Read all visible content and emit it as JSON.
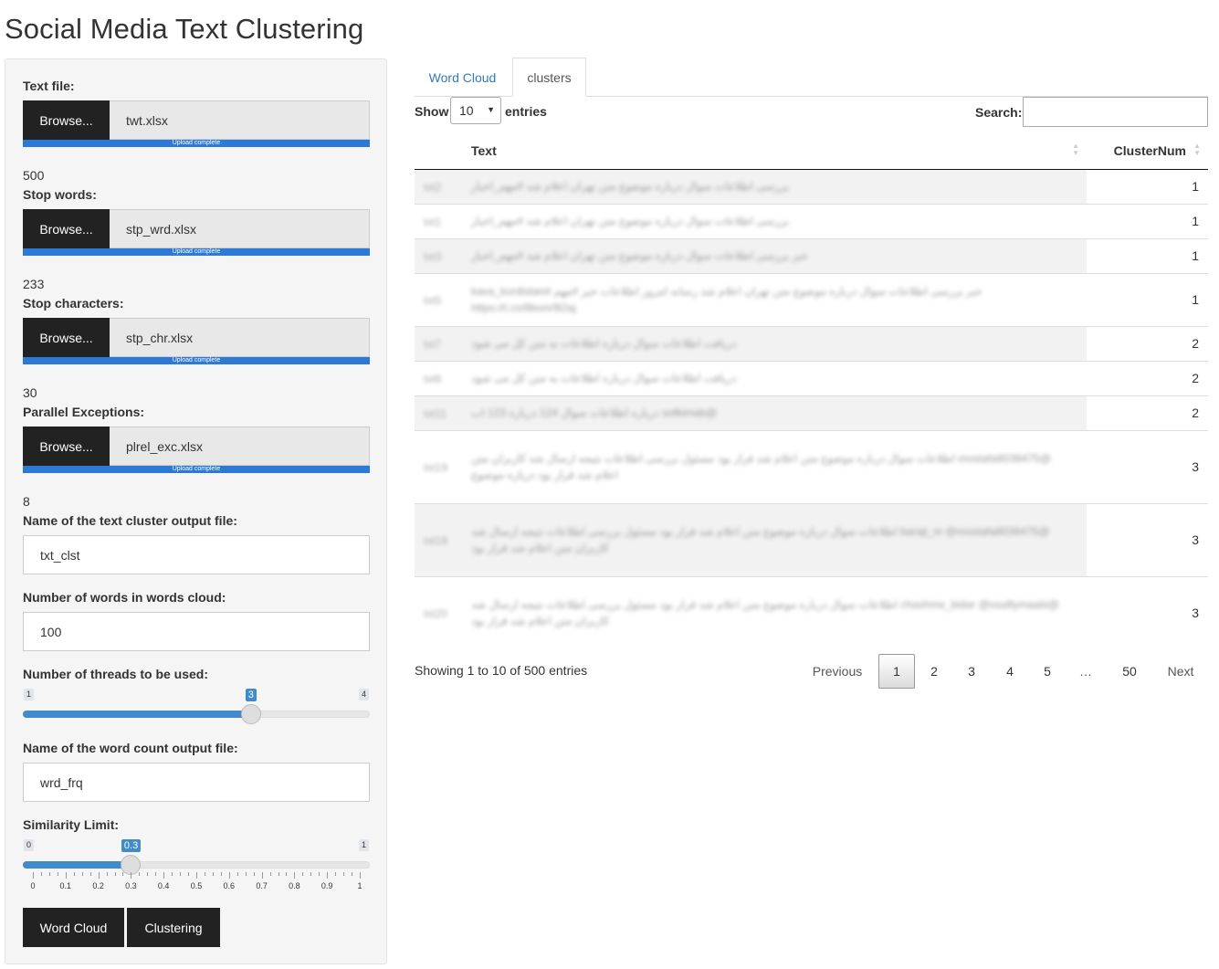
{
  "app_title": "Social Media Text Clustering",
  "sidebar": {
    "text_file": {
      "label": "Text file:",
      "browse": "Browse...",
      "file": "twt.xlsx",
      "progress": "Upload complete"
    },
    "count_500": "500",
    "stop_words": {
      "label": "Stop words:",
      "browse": "Browse...",
      "file": "stp_wrd.xlsx",
      "progress": "Upload complete"
    },
    "count_233": "233",
    "stop_chars": {
      "label": "Stop characters:",
      "browse": "Browse...",
      "file": "stp_chr.xlsx",
      "progress": "Upload complete"
    },
    "count_30": "30",
    "parallel_exc": {
      "label": "Parallel Exceptions:",
      "browse": "Browse...",
      "file": "plrel_exc.xlsx",
      "progress": "Upload complete"
    },
    "count_8": "8",
    "cluster_output": {
      "label": "Name of the text cluster output file:",
      "value": "txt_clst"
    },
    "words_cloud": {
      "label": "Number of words in words cloud:",
      "value": "100"
    },
    "threads": {
      "label": "Number of threads to be used:",
      "min": "1",
      "max": "4",
      "value": 3,
      "value_label": "3",
      "fraction": 0.667
    },
    "word_count_output": {
      "label": "Name of the word count output file:",
      "value": "wrd_frq"
    },
    "similarity": {
      "label": "Similarity Limit:",
      "min": "0",
      "max": "1",
      "value": 0.3,
      "value_label": "0.3",
      "fraction": 0.3,
      "ticks": [
        "0",
        "0.1",
        "0.2",
        "0.3",
        "0.4",
        "0.5",
        "0.6",
        "0.7",
        "0.8",
        "0.9",
        "1"
      ]
    },
    "buttons": {
      "word_cloud": "Word Cloud",
      "clustering": "Clustering"
    }
  },
  "tabs": {
    "word_cloud": "Word Cloud",
    "clusters": "clusters"
  },
  "table_controls": {
    "show": "Show",
    "page_size": "10",
    "entries": "entries",
    "search_label": "Search:"
  },
  "table": {
    "columns": [
      "",
      "Text",
      "ClusterNum"
    ],
    "rows": [
      {
        "id": "txt2",
        "text": "بررسی اطلاعات سوال درباره موضوع متن تهران اعلام شد #مهم_اخبار",
        "cluster": "1"
      },
      {
        "id": "txt1",
        "text": "بررسی اطلاعات سوال درباره موضوع متن تهران اعلام شد #مهم_اخبار",
        "cluster": "1"
      },
      {
        "id": "txt3",
        "text": "خبر بررسی اطلاعات سوال درباره موضوع متن تهران اعلام شد #مهم_اخبار",
        "cluster": "1"
      },
      {
        "id": "txt5",
        "text": "خبر بررسی اطلاعات سوال درباره موضوع متن تهران اعلام شد رسانه امروز اطلاعات خبر #مهم #kava_kurdistan https://t.co/8bonr9l2aj",
        "cluster": "1"
      },
      {
        "id": "txt7",
        "text": "دریافت اطلاعات سوال درباره اطلاعات به متن کل می شود",
        "cluster": "2"
      },
      {
        "id": "txt6",
        "text": "دریافت اطلاعات سوال درباره اطلاعات به متن کل می شود",
        "cluster": "2"
      },
      {
        "id": "txt11",
        "text": "@sofkimab درباره اطلاعات سوال 124 درباره 123 اب",
        "cluster": "2"
      },
      {
        "id": "txt19",
        "text": "@mostafa8038475 اطلاعات سوال درباره موضوع متن اعلام شد قرار بود مسئول بررسی اطلاعات نتیجه ارسال شد کاربران متن اعلام شد قرار بود درباره موضوع",
        "cluster": "3"
      },
      {
        "id": "txt18",
        "text": "@baraji_m @mostafa8038475 اطلاعات سوال درباره موضوع متن اعلام شد قرار بود مسئول بررسی اطلاعات نتیجه ارسال شد کاربران متن اعلام شد قرار بود",
        "cluster": "3"
      },
      {
        "id": "txt20",
        "text": "@chashme_bidar @osaflymaabi اطلاعات سوال درباره موضوع متن اعلام شد قرار بود مسئول بررسی اطلاعات نتیجه ارسال شد کاربران متن اعلام شد قرار بود",
        "cluster": "3"
      }
    ]
  },
  "footer": {
    "info": "Showing 1 to 10 of 500 entries",
    "previous": "Previous",
    "pages": [
      "1",
      "2",
      "3",
      "4",
      "5",
      "…",
      "50"
    ],
    "next": "Next"
  }
}
